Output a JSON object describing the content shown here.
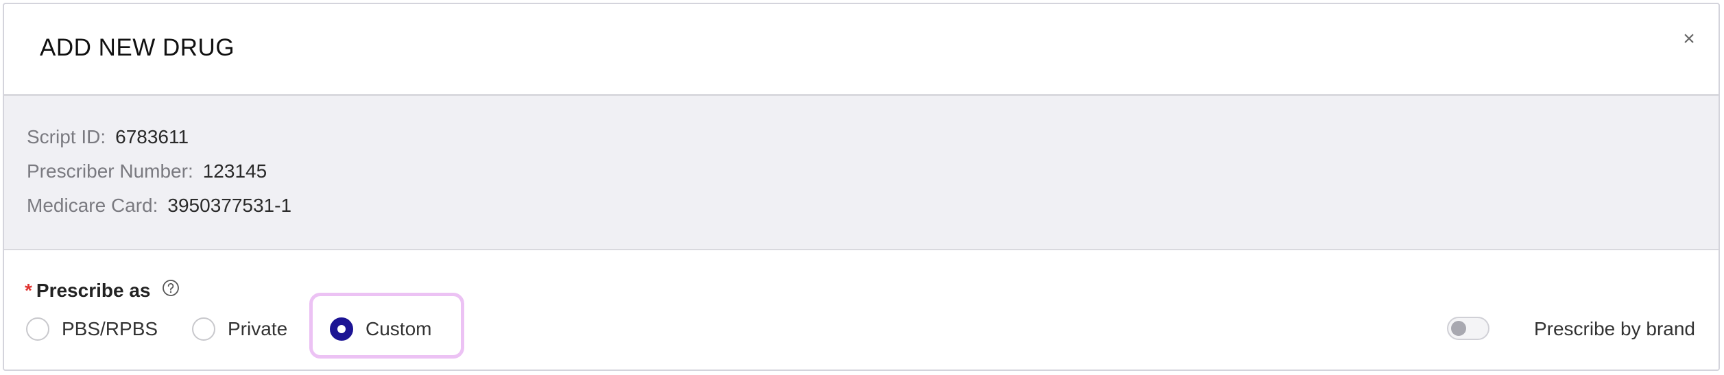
{
  "modal": {
    "title": "ADD NEW DRUG",
    "close_label": "×"
  },
  "info": {
    "script_id_label": "Script ID:",
    "script_id_value": "6783611",
    "prescriber_number_label": "Prescriber Number:",
    "prescriber_number_value": "123145",
    "medicare_card_label": "Medicare Card:",
    "medicare_card_value": "3950377531-1"
  },
  "prescribe_as": {
    "required_mark": "*",
    "label": "Prescribe as",
    "help_icon": "question-circle-icon",
    "options": [
      {
        "label": "PBS/RPBS",
        "checked": false
      },
      {
        "label": "Private",
        "checked": false
      },
      {
        "label": "Custom",
        "checked": true
      }
    ],
    "selected": "Custom"
  },
  "prescribe_by_brand": {
    "label": "Prescribe by brand",
    "enabled": false
  },
  "colors": {
    "accent": "#1c1494",
    "focus_ring": "#ecc2f4",
    "required": "#e0312e",
    "info_panel_bg": "#f0f0f4"
  }
}
